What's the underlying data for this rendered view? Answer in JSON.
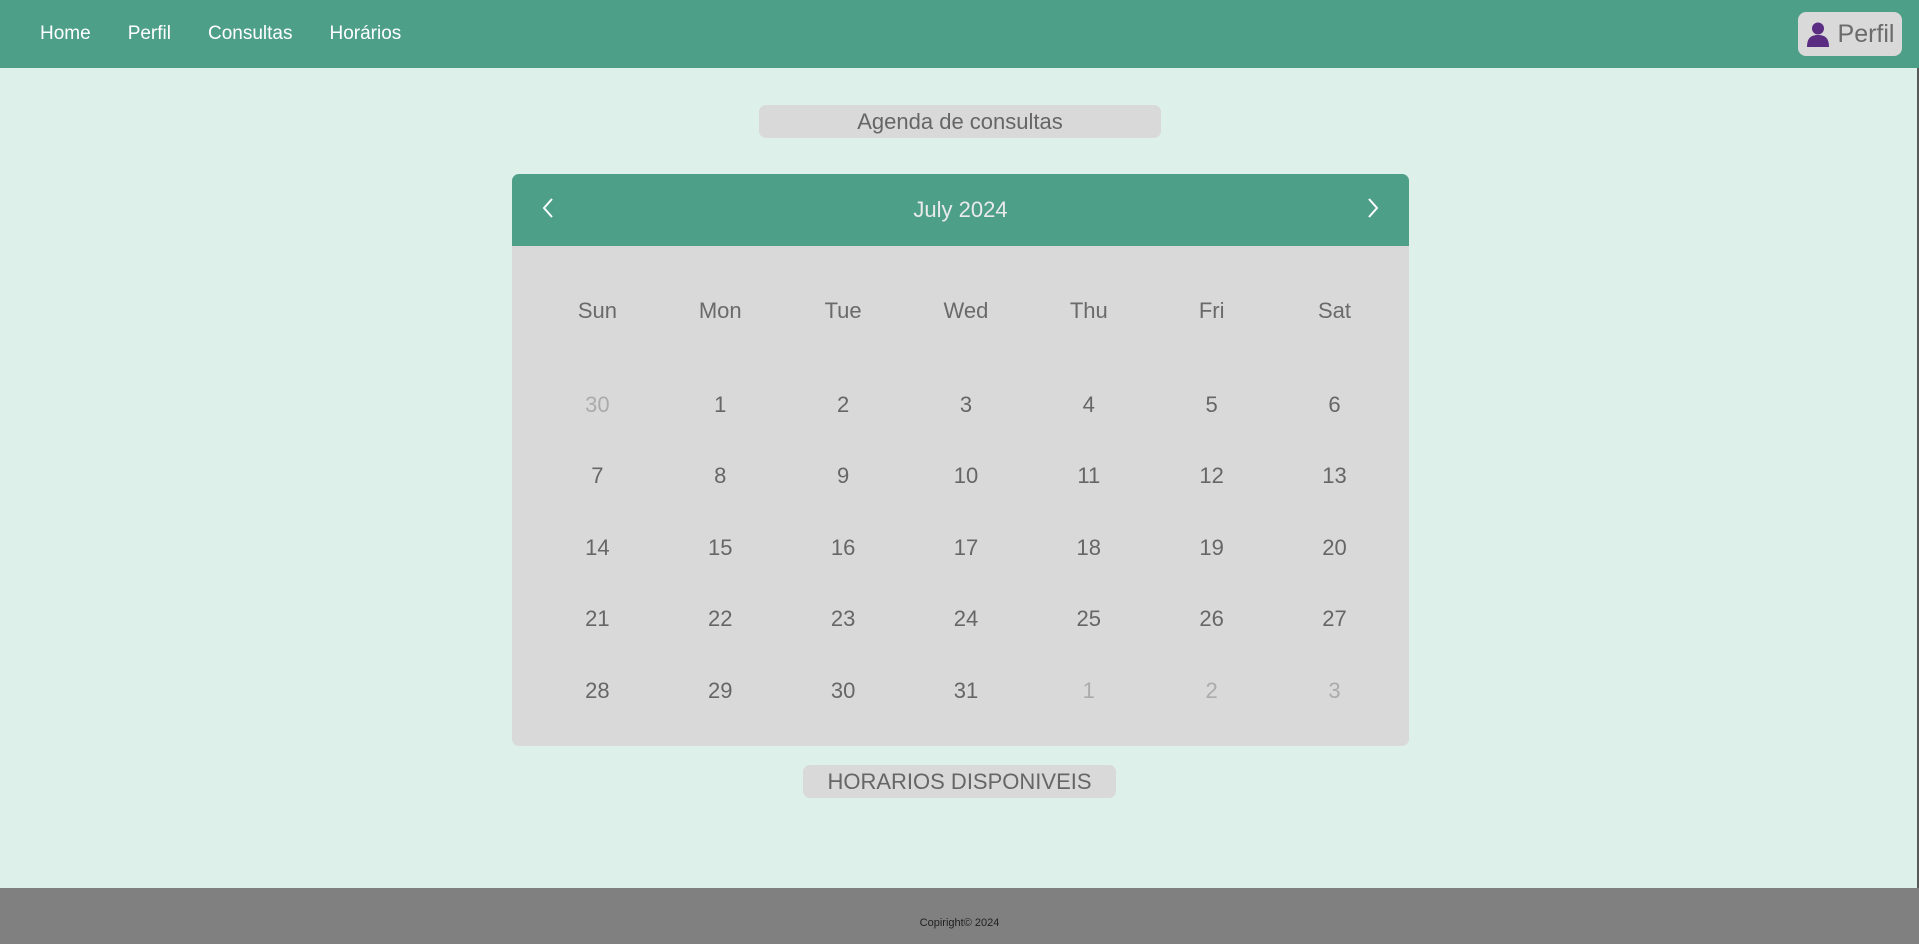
{
  "nav": {
    "links": [
      "Home",
      "Perfil",
      "Consultas",
      "Horários"
    ],
    "profile_label": "Perfil"
  },
  "page_title": "Agenda de consultas",
  "calendar": {
    "month_label": "July 2024",
    "weekdays": [
      "Sun",
      "Mon",
      "Tue",
      "Wed",
      "Thu",
      "Fri",
      "Sat"
    ],
    "days": [
      {
        "label": "30",
        "muted": true
      },
      {
        "label": "1",
        "muted": false
      },
      {
        "label": "2",
        "muted": false
      },
      {
        "label": "3",
        "muted": false
      },
      {
        "label": "4",
        "muted": false
      },
      {
        "label": "5",
        "muted": false
      },
      {
        "label": "6",
        "muted": false
      },
      {
        "label": "7",
        "muted": false
      },
      {
        "label": "8",
        "muted": false
      },
      {
        "label": "9",
        "muted": false
      },
      {
        "label": "10",
        "muted": false
      },
      {
        "label": "11",
        "muted": false
      },
      {
        "label": "12",
        "muted": false
      },
      {
        "label": "13",
        "muted": false
      },
      {
        "label": "14",
        "muted": false
      },
      {
        "label": "15",
        "muted": false
      },
      {
        "label": "16",
        "muted": false
      },
      {
        "label": "17",
        "muted": false
      },
      {
        "label": "18",
        "muted": false
      },
      {
        "label": "19",
        "muted": false
      },
      {
        "label": "20",
        "muted": false
      },
      {
        "label": "21",
        "muted": false
      },
      {
        "label": "22",
        "muted": false
      },
      {
        "label": "23",
        "muted": false
      },
      {
        "label": "24",
        "muted": false
      },
      {
        "label": "25",
        "muted": false
      },
      {
        "label": "26",
        "muted": false
      },
      {
        "label": "27",
        "muted": false
      },
      {
        "label": "28",
        "muted": false
      },
      {
        "label": "29",
        "muted": false
      },
      {
        "label": "30",
        "muted": false
      },
      {
        "label": "31",
        "muted": false
      },
      {
        "label": "1",
        "muted": true
      },
      {
        "label": "2",
        "muted": true
      },
      {
        "label": "3",
        "muted": true
      }
    ]
  },
  "slots_button": "HORARIOS DISPONIVEIS",
  "footer": {
    "copyright": "Copiright© 2024"
  },
  "icons": {
    "user": "user-icon",
    "prev": "chevron-left-icon",
    "next": "chevron-right-icon"
  },
  "colors": {
    "primary": "#4e9f88",
    "background": "#ddf0ea",
    "panel": "#d9d9d9",
    "footer": "#808080",
    "user_icon": "#5a2d82"
  }
}
